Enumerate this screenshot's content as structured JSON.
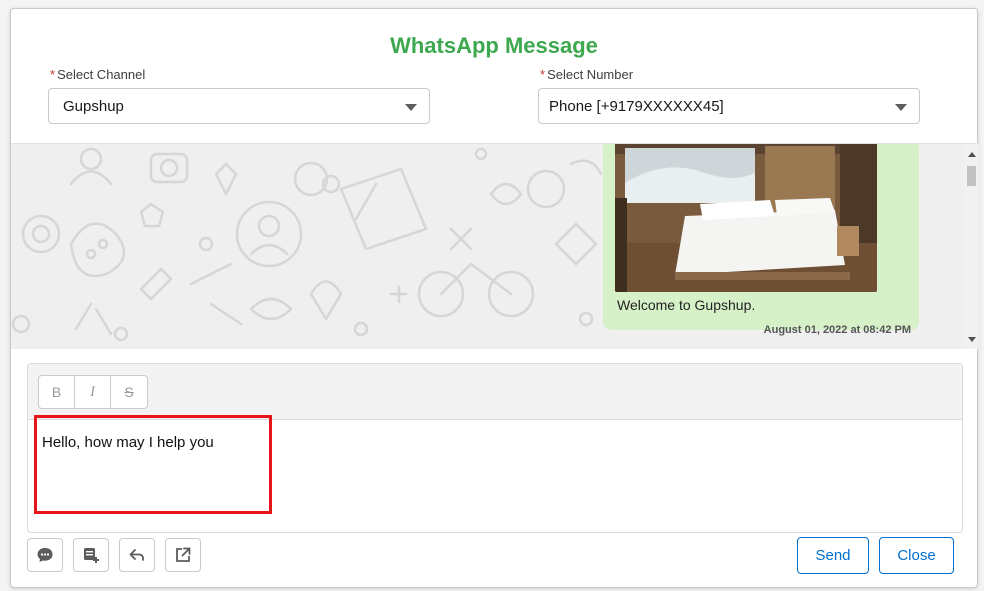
{
  "modal": {
    "title": "WhatsApp Message",
    "accent_color": "#3ea84f"
  },
  "channel": {
    "label": "Select Channel",
    "required_mark": "*",
    "value": "Gupshup"
  },
  "number": {
    "label": "Select Number",
    "required_mark": "*",
    "value": "Phone [+9179XXXXXX45]"
  },
  "chat": {
    "message_image": "hotel-bedroom-image",
    "message_text": "Welcome to Gupshup.",
    "message_time": "August 01, 2022 at 08:42 PM",
    "bubble_color": "#d6f1c8"
  },
  "editor": {
    "format_buttons": [
      {
        "label": "B",
        "name": "bold"
      },
      {
        "label": "I",
        "name": "italic"
      },
      {
        "label": "S",
        "name": "strikethrough"
      }
    ],
    "content": "Hello, how may I help you",
    "highlight_color": "#e8141b"
  },
  "actions": {
    "icons": [
      "chat-bubble-icon",
      "template-add-icon",
      "reply-icon",
      "external-link-icon"
    ],
    "send_label": "Send",
    "close_label": "Close",
    "brand_color": "#0070d2"
  }
}
